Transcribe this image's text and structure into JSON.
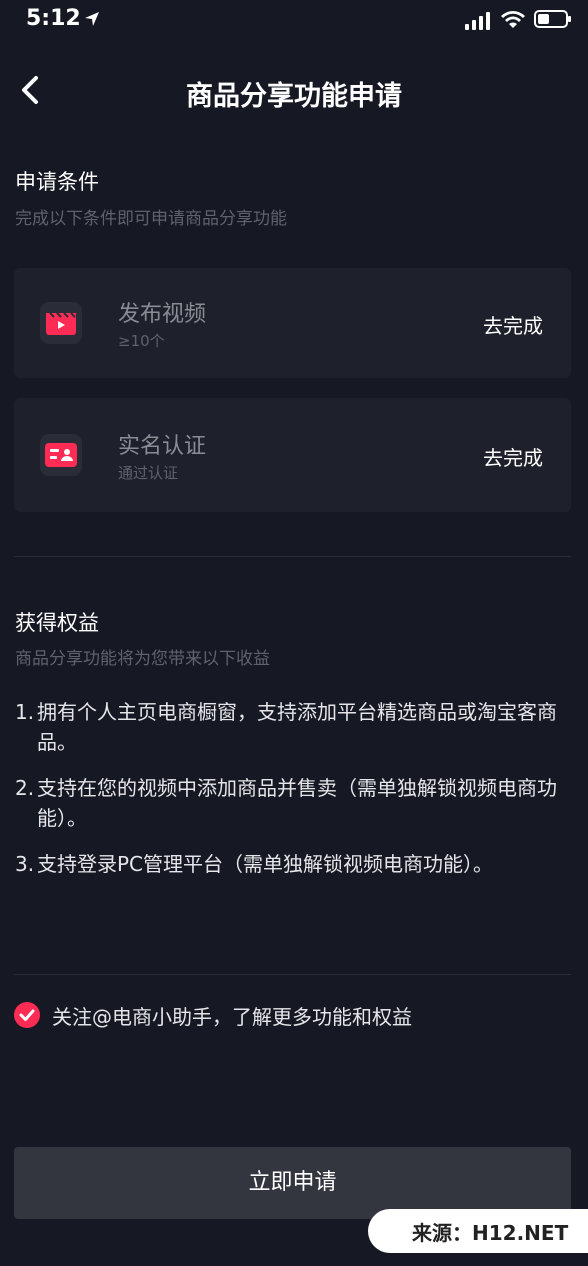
{
  "status_bar": {
    "time": "5:12"
  },
  "nav": {
    "title": "商品分享功能申请"
  },
  "conditions": {
    "title": "申请条件",
    "subtitle": "完成以下条件即可申请商品分享功能",
    "items": [
      {
        "icon": "video-clapper-icon",
        "title": "发布视频",
        "sub": "≥10个",
        "action": "去完成"
      },
      {
        "icon": "id-card-icon",
        "title": "实名认证",
        "sub": "通过认证",
        "action": "去完成"
      }
    ]
  },
  "benefits": {
    "title": "获得权益",
    "subtitle": "商品分享功能将为您带来以下收益",
    "items": [
      {
        "num": "1.",
        "text": "拥有个人主页电商橱窗，支持添加平台精选商品或淘宝客商品。"
      },
      {
        "num": "2.",
        "text": "支持在您的视频中添加商品并售卖（需单独解锁视频电商功能）。"
      },
      {
        "num": "3.",
        "text": "支持登录PC管理平台（需单独解锁视频电商功能）。"
      }
    ]
  },
  "agreement": {
    "checked": true,
    "text": "关注@电商小助手，了解更多功能和权益"
  },
  "apply_button": {
    "label": "立即申请"
  },
  "watermark": {
    "text": "来源：H12.NET"
  },
  "colors": {
    "accent": "#fe2c55",
    "background": "#161823",
    "card": "#1e202b"
  }
}
